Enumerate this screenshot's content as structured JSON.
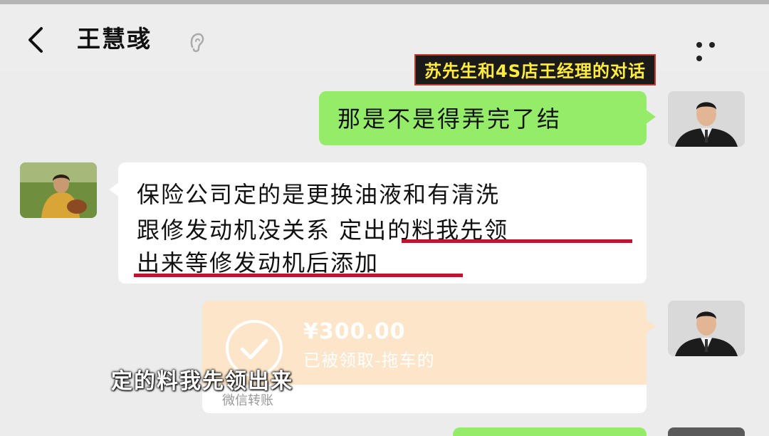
{
  "header": {
    "title": "王慧彧",
    "back_icon": "chevron-left-icon",
    "ear_icon": "ear-icon",
    "more_icon": "more-dots-icon"
  },
  "overlay": {
    "caption": "苏先生和4S店王经理的对话",
    "subtitle": "定的料我先领出来"
  },
  "messages": [
    {
      "side": "right",
      "text": "那是不是得弄完了结"
    },
    {
      "side": "left",
      "lines": [
        "保险公司定的是更换油液和有清洗",
        "跟修发动机没关系 定出的料我先领",
        "出来等修发动机后添加"
      ]
    }
  ],
  "transfer": {
    "amount": "¥300.00",
    "status": "已被领取-拖车的",
    "footer": "微信转账",
    "icon": "check-circle-icon"
  },
  "colors": {
    "bg": "#ececec",
    "sent_bubble": "#95ec69",
    "received_bubble": "#ffffff",
    "transfer_bubble": "#fce5c8",
    "underline": "#c8102e",
    "caption_text": "#ffeb3b"
  }
}
